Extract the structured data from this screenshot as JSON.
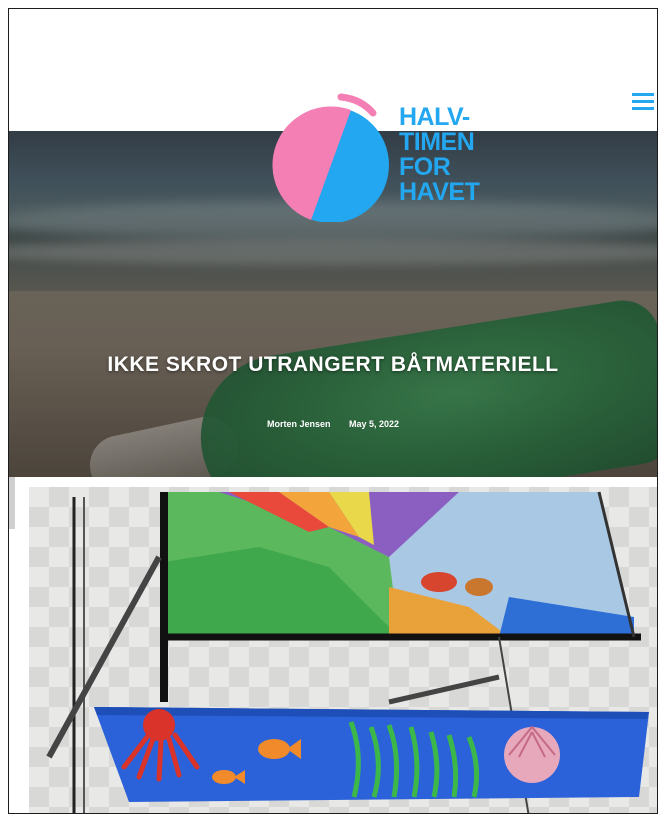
{
  "site": {
    "logo_lines": [
      "HALV-",
      "TIMEN",
      "FOR",
      "HAVET"
    ],
    "logo_colors": {
      "pink": "#f47fb4",
      "blue": "#22a7f0"
    }
  },
  "header": {
    "menu_icon": "hamburger-menu-icon"
  },
  "article": {
    "title": "IKKE SKROT UTRANGERT BÅTMATERIELL",
    "author": "Morten Jensen",
    "date": "May 5, 2022"
  },
  "colors": {
    "accent": "#22a7f0",
    "title_text": "#ffffff"
  }
}
